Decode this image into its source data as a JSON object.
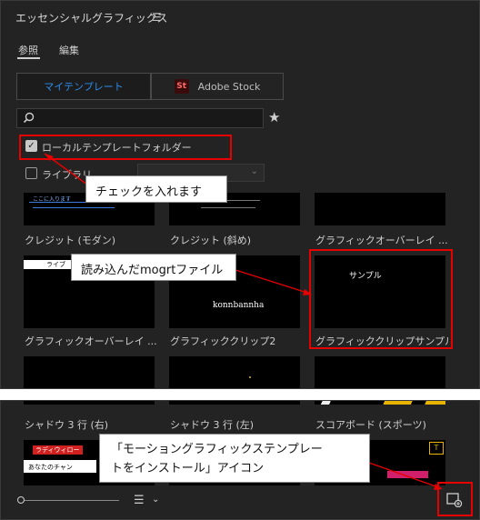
{
  "panel": {
    "title": "エッセンシャルグラフィックス",
    "menu_icon": "hamburger-icon"
  },
  "tabs": [
    {
      "label": "参照"
    },
    {
      "label": "編集"
    }
  ],
  "source_toggle": {
    "my_templates": "マイテンプレート",
    "adobe_stock_badge": "St",
    "adobe_stock": "Adobe Stock"
  },
  "search": {
    "placeholder": ""
  },
  "filters": {
    "local_folder": "ローカルテンプレートフォルダー",
    "library": "ライブラリ"
  },
  "rows": [
    {
      "items": [
        {
          "caption": "クレジット (モダン)"
        },
        {
          "caption": "クレジット (斜め)"
        },
        {
          "caption": "グラフィックオーバーレイ ..."
        }
      ]
    },
    {
      "items": [
        {
          "caption": "グラフィックオーバーレイ ..."
        },
        {
          "caption": "グラフィッククリップ2",
          "thumb_text": "konnbannha"
        },
        {
          "caption": "グラフィッククリップサンプル",
          "thumb_text": "サンプル"
        }
      ]
    },
    {
      "items": [
        {
          "caption": "シャドウ 3 行 (右)"
        },
        {
          "caption": "シャドウ 3 行 (左)"
        },
        {
          "caption": "スコアボード (スポーツ)"
        }
      ]
    }
  ],
  "thumb_snippets": {
    "credit_modern": "ここに入ります",
    "overlay_top": "ライブ",
    "row4_a": "ラディウィロー",
    "row4_b": "あなたのチャン"
  },
  "callouts": {
    "check": "チェックを入れます",
    "mogrt": "読み込んだmogrtファイル",
    "install_line1": "「モーショングラフィックステンプレー",
    "install_line2": "トをインストール」アイコン"
  },
  "footer": {
    "install_icon": "install-template-icon",
    "list_icon": "list-view-icon"
  },
  "colors": {
    "accent": "#2d8ceb",
    "highlight": "#e60000",
    "panel_bg": "#232323"
  }
}
